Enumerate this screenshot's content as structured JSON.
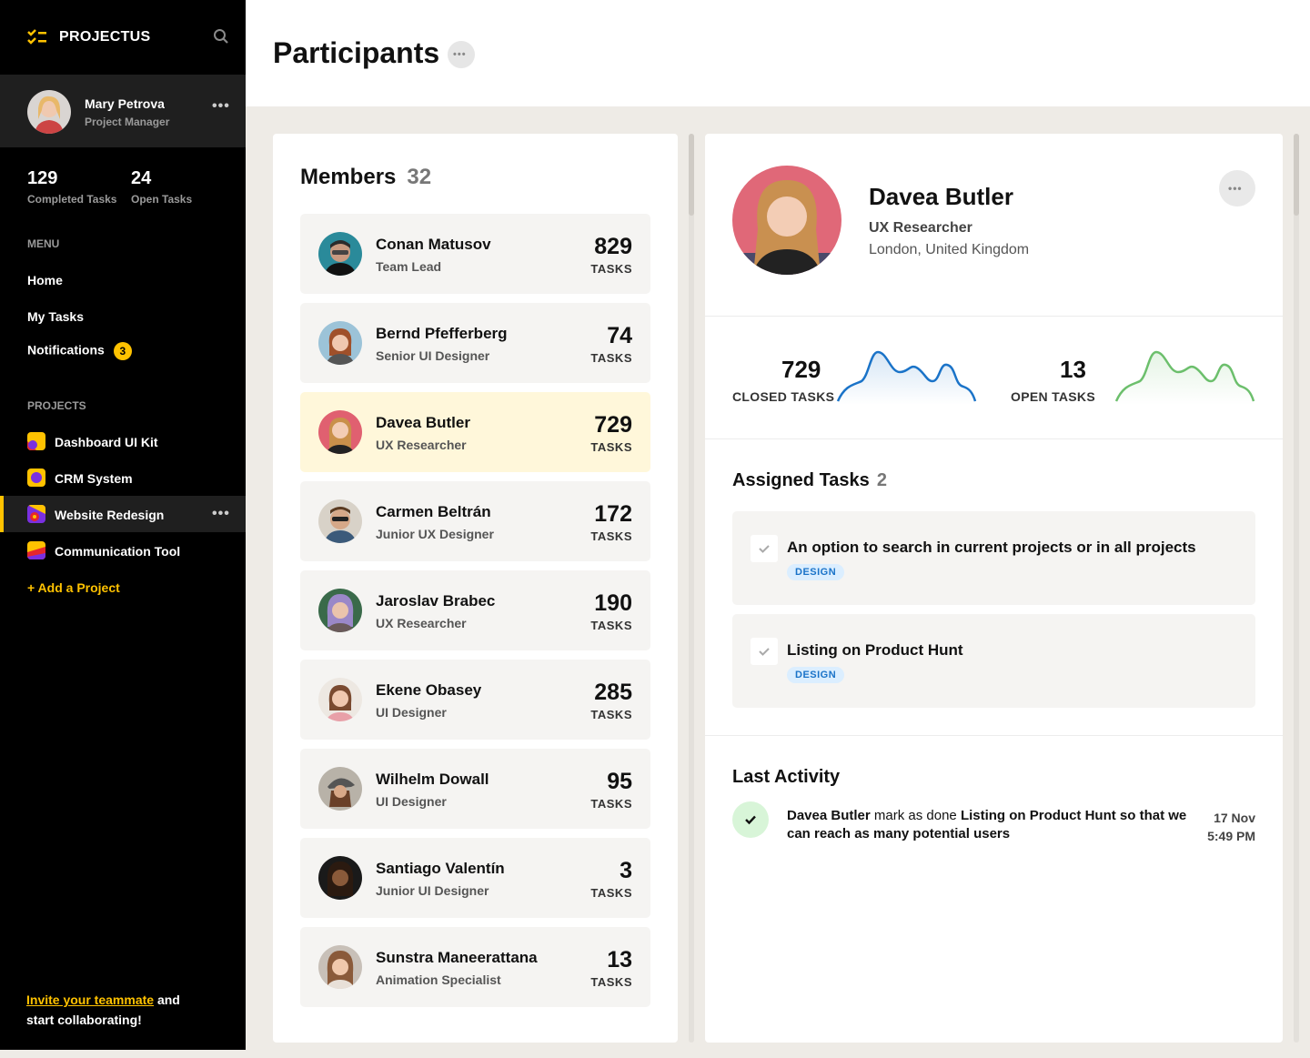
{
  "app": {
    "name": "PROJECTUS"
  },
  "user": {
    "name": "Mary Petrova",
    "role": "Project Manager"
  },
  "stats": [
    {
      "value": "129",
      "label": "Completed Tasks"
    },
    {
      "value": "24",
      "label": "Open Tasks"
    }
  ],
  "menu": {
    "title": "MENU",
    "home": "Home",
    "my_tasks": "My Tasks",
    "notifications": "Notifications",
    "notifications_badge": "3"
  },
  "projects": {
    "title": "PROJECTS",
    "items": [
      {
        "label": "Dashboard UI Kit"
      },
      {
        "label": "CRM System"
      },
      {
        "label": "Website Redesign"
      },
      {
        "label": "Communication Tool"
      }
    ],
    "add_label": "+ Add a Project"
  },
  "invite": {
    "link": "Invite your teammate",
    "rest1": " and",
    "rest2": "start collaborating!"
  },
  "page": {
    "title": "Participants"
  },
  "members": {
    "title": "Members",
    "count": "32",
    "tasks_label": "TASKS",
    "items": [
      {
        "name": "Conan Matusov",
        "role": "Team Lead",
        "tasks": "829"
      },
      {
        "name": "Bernd Pfefferberg",
        "role": "Senior UI Designer",
        "tasks": "74"
      },
      {
        "name": "Davea Butler",
        "role": "UX Researcher",
        "tasks": "729"
      },
      {
        "name": "Carmen Beltrán",
        "role": "Junior UX Designer",
        "tasks": "172"
      },
      {
        "name": "Jaroslav Brabec",
        "role": "UX Researcher",
        "tasks": "190"
      },
      {
        "name": "Ekene Obasey",
        "role": "UI Designer",
        "tasks": "285"
      },
      {
        "name": "Wilhelm Dowall",
        "role": "UI Designer",
        "tasks": "95"
      },
      {
        "name": "Santiago Valentín",
        "role": "Junior UI Designer",
        "tasks": "3"
      },
      {
        "name": "Sunstra Maneerattana",
        "role": "Animation Specialist",
        "tasks": "13"
      }
    ]
  },
  "profile": {
    "name": "Davea Butler",
    "role": "UX Researcher",
    "location": "London, United Kingdom",
    "closed_value": "729",
    "closed_label": "CLOSED TASKS",
    "open_value": "13",
    "open_label": "OPEN TASKS"
  },
  "assigned": {
    "title": "Assigned Tasks",
    "count": "2",
    "items": [
      {
        "text": "An option to search in current projects or in all projects",
        "tag": "DESIGN"
      },
      {
        "text": "Listing on Product Hunt",
        "tag": "DESIGN"
      }
    ]
  },
  "activity": {
    "title": "Last Activity",
    "actor": "Davea Butler",
    "verb": " mark as done ",
    "object": "Listing on Product Hunt so that we can reach as many potential users",
    "date": "17 Nov",
    "time": "5:49 PM"
  },
  "colors": {
    "accent": "#ffc200",
    "sidebar": "#000000",
    "closed_line": "#1a73c8",
    "open_line": "#6cbf6c"
  }
}
